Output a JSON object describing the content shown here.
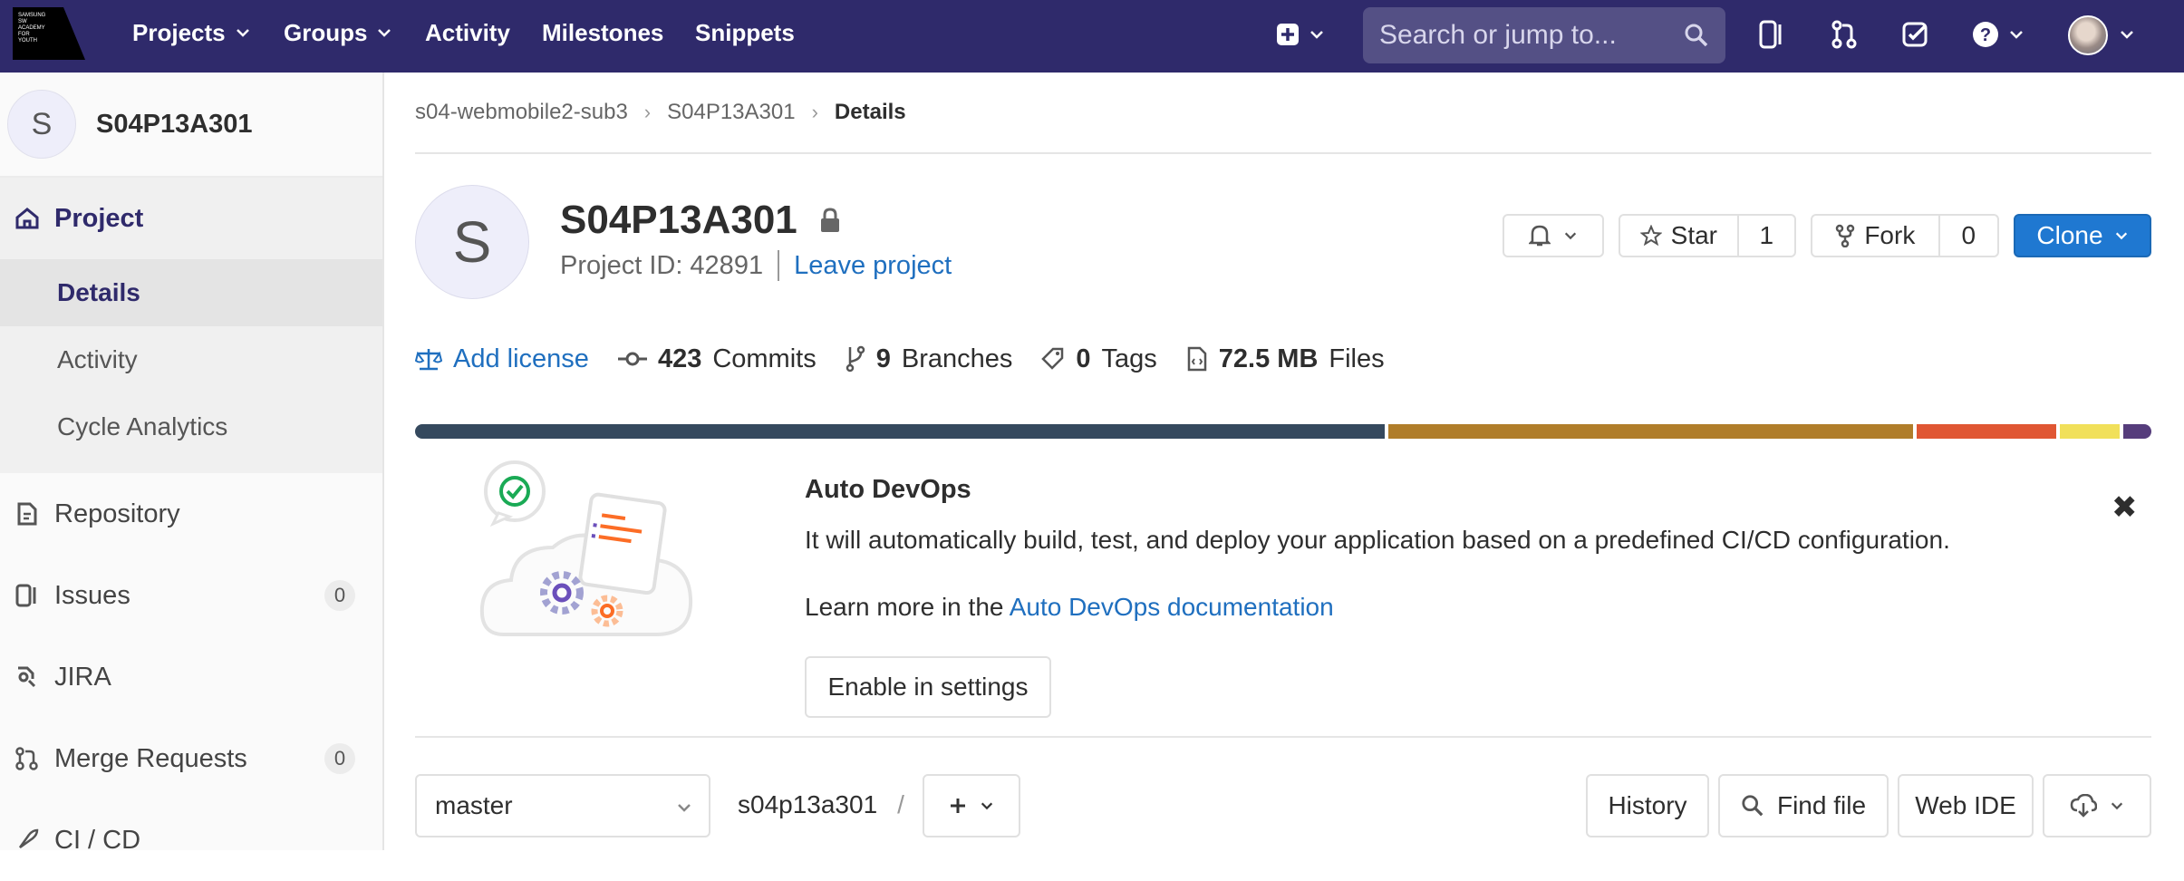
{
  "nav": {
    "logo_lines": [
      "SAMSUNG",
      "SW",
      "ACADEMY",
      "FOR",
      "YOUTH"
    ],
    "items": [
      {
        "label": "Projects",
        "has_dropdown": true
      },
      {
        "label": "Groups",
        "has_dropdown": true
      },
      {
        "label": "Activity",
        "has_dropdown": false
      },
      {
        "label": "Milestones",
        "has_dropdown": false
      },
      {
        "label": "Snippets",
        "has_dropdown": false
      }
    ],
    "search_placeholder": "Search or jump to...",
    "icons": [
      "plus-square-icon",
      "issues-icon",
      "merge-request-icon",
      "todo-icon",
      "help-icon",
      "user-avatar"
    ]
  },
  "sidebar": {
    "project_initial": "S",
    "project_name": "S04P13A301",
    "section_title": "Project",
    "sub_items": [
      "Details",
      "Activity",
      "Cycle Analytics"
    ],
    "current_sub": "Details",
    "items": [
      {
        "label": "Repository",
        "icon": "doc-icon"
      },
      {
        "label": "Issues",
        "icon": "issues-icon",
        "count": "0"
      },
      {
        "label": "JIRA",
        "icon": "jira-icon"
      },
      {
        "label": "Merge Requests",
        "icon": "merge-request-icon",
        "count": "0"
      },
      {
        "label": "CI / CD",
        "icon": "rocket-icon"
      }
    ]
  },
  "breadcrumb": [
    "s04-webmobile2-sub3",
    "S04P13A301",
    "Details"
  ],
  "project": {
    "initial": "S",
    "title": "S04P13A301",
    "id_text": "Project ID: 42891",
    "leave_label": "Leave project",
    "star_label": "Star",
    "star_count": "1",
    "fork_label": "Fork",
    "fork_count": "0",
    "clone_label": "Clone"
  },
  "stats": {
    "license": "Add license",
    "commits_num": "423",
    "commits_label": "Commits",
    "branches_num": "9",
    "branches_label": "Branches",
    "tags_num": "0",
    "tags_label": "Tags",
    "files_num": "72.5 MB",
    "files_label": "Files"
  },
  "languages": [
    {
      "fraction": 0.451,
      "color": "#35495e"
    },
    {
      "fraction": 0.244,
      "color": "#b07d2a"
    },
    {
      "fraction": 0.065,
      "color": "#e05633"
    },
    {
      "fraction": 0.028,
      "color": "#f1e05a"
    },
    {
      "fraction": 0.013,
      "color": "#563d7c"
    }
  ],
  "devops": {
    "title": "Auto DevOps",
    "description": "It will automatically build, test, and deploy your application based on a predefined CI/CD configuration.",
    "learn_prefix": "Learn more in the",
    "learn_link": "Auto DevOps documentation",
    "enable_label": "Enable in settings"
  },
  "toolbar": {
    "branch": "master",
    "path": "s04p13a301",
    "path_sep": "/",
    "history_label": "History",
    "find_file_label": "Find file",
    "web_ide_label": "Web IDE"
  },
  "colors": {
    "nav_bg": "#2f2a6b",
    "link": "#1f6fbf",
    "primary_button": "#1f78d1"
  }
}
